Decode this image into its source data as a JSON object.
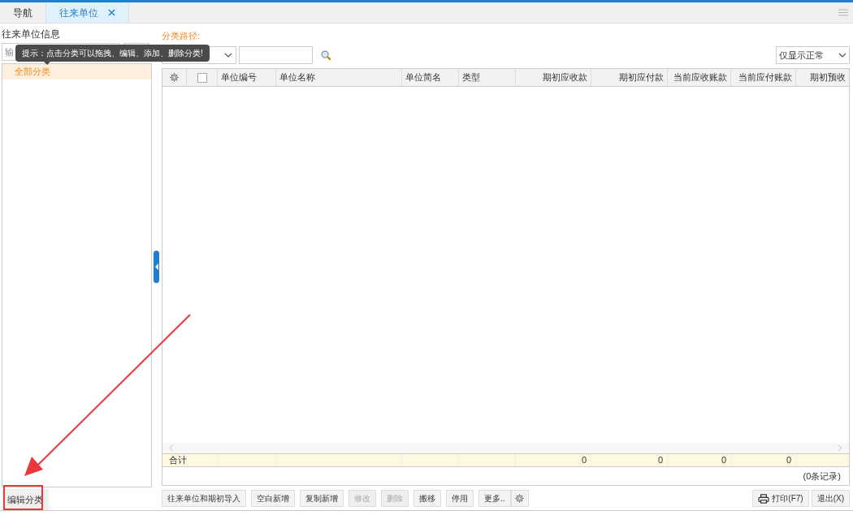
{
  "tabs": [
    {
      "label": "导航",
      "selected": false,
      "closable": false
    },
    {
      "label": "往来单位",
      "selected": true,
      "closable": true
    }
  ],
  "left_panel": {
    "title": "往来单位信息",
    "search": {
      "placeholder": "输"
    },
    "tree": [
      {
        "label": "全部分类",
        "selected": true
      }
    ],
    "edit_button": "编辑分类"
  },
  "tooltip": "提示：点击分类可以拖拽、编辑、添加、删除分类!",
  "category_path_label": "分类路径:",
  "status_filter": "仅显示正常",
  "table": {
    "select_all_checked": false,
    "columns": [
      {
        "label": "单位编号"
      },
      {
        "label": "单位名称"
      },
      {
        "label": "单位简名"
      },
      {
        "label": "类型"
      },
      {
        "label": "期初应收款",
        "total": "0"
      },
      {
        "label": "期初应付款",
        "total": "0"
      },
      {
        "label": "当前应收账款",
        "total": "0"
      },
      {
        "label": "当前应付账款",
        "total": "0"
      },
      {
        "label": "期初预收"
      }
    ],
    "totals_label": "合计",
    "record_count": "(0条记录)"
  },
  "buttons": [
    {
      "label": "往来单位和期初导入",
      "disabled": false
    },
    {
      "label": "空白新增",
      "disabled": false
    },
    {
      "label": "复制新增",
      "disabled": false
    },
    {
      "label": "修改",
      "disabled": true
    },
    {
      "label": "删除",
      "disabled": true
    },
    {
      "label": "搬移",
      "disabled": false
    },
    {
      "label": "停用",
      "disabled": false
    },
    {
      "label": "更多..",
      "disabled": false
    }
  ],
  "print_button": "打印(F7)",
  "exit_button": "退出(X)"
}
